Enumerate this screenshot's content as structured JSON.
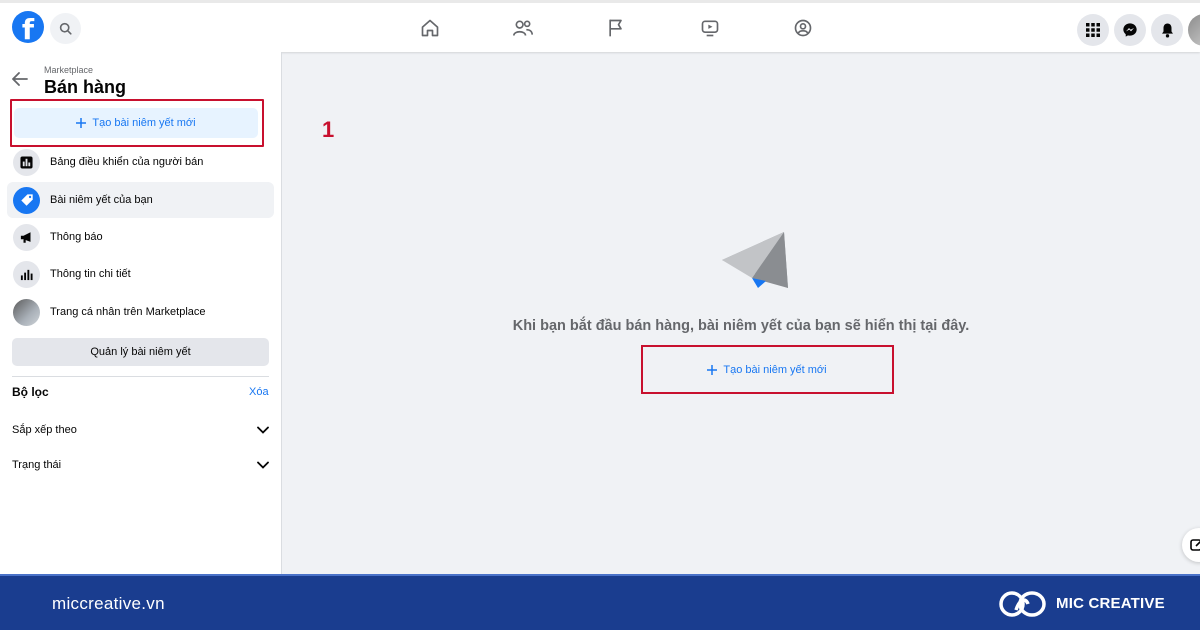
{
  "topbar": {
    "logo_letter": "f",
    "icons": [
      "search-icon",
      "home-icon",
      "friends-icon",
      "flag-icon",
      "video-icon",
      "groups-icon",
      "menu-grid-icon",
      "messenger-icon",
      "bell-icon"
    ]
  },
  "sidebar": {
    "breadcrumb": "Marketplace",
    "title": "Bán hàng",
    "create_button": "Tạo bài niêm yết mới",
    "items": [
      {
        "label": "Bảng điều khiển của người bán",
        "icon": "dashboard-icon",
        "active": false
      },
      {
        "label": "Bài niêm yết của bạn",
        "icon": "tag-icon",
        "active": true
      },
      {
        "label": "Thông báo",
        "icon": "megaphone-icon",
        "active": false
      },
      {
        "label": "Thông tin chi tiết",
        "icon": "bar-chart-icon",
        "active": false
      },
      {
        "label": "Trang cá nhân trên Marketplace",
        "icon": "profile-photo-icon",
        "active": false
      }
    ],
    "manage_button": "Quản lý bài niêm yết",
    "filters": {
      "title": "Bộ lọc",
      "clear": "Xóa",
      "rows": [
        {
          "label": "Sắp xếp theo"
        },
        {
          "label": "Trạng thái"
        }
      ]
    }
  },
  "annotation": {
    "step": "1",
    "highlight_color": "#c8102e"
  },
  "main": {
    "empty_message": "Khi bạn bắt đầu bán hàng, bài niêm yết của bạn sẽ hiển thị tại đây.",
    "create_button": "Tạo bài niêm yết mới"
  },
  "footer": {
    "site": "miccreative.vn",
    "brand": "MIC CREATIVE"
  },
  "colors": {
    "accent": "#1877f2",
    "footer_bg": "#1a3d8f",
    "page_bg": "#f0f2f5"
  }
}
